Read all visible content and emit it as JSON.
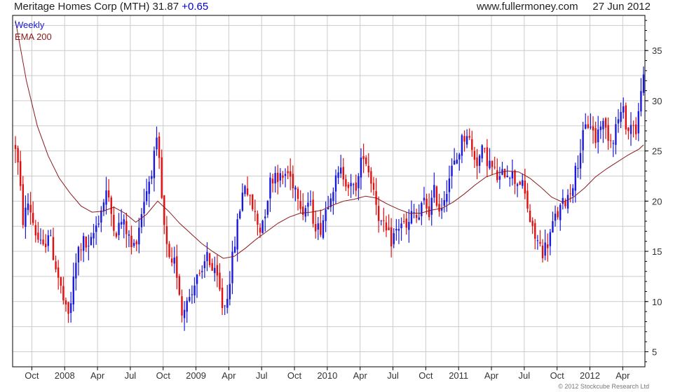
{
  "header": {
    "company": "Meritage Homes Corp (MTH)",
    "price": "31.87",
    "change": "+0.65",
    "site": "www.fullermoney.com",
    "date": "27 Jun 2012"
  },
  "legend": {
    "period": "Weekly",
    "indicator": "EMA 200"
  },
  "copyright": "© 2012 Stockcube Research Ltd",
  "colors": {
    "up": "#1a1adc",
    "down": "#e01010",
    "ema": "#8b1a1a",
    "grid": "#cccccc",
    "axis": "#000000"
  },
  "chart_data": {
    "type": "candlestick",
    "title": "Meritage Homes Corp (MTH) 31.87 +0.65",
    "frequency": "Weekly",
    "ylim": [
      3.5,
      38.5
    ],
    "y_ticks": [
      5,
      10,
      15,
      20,
      25,
      30,
      35
    ],
    "x_ticks": [
      {
        "label": "Oct",
        "t": 1.5
      },
      {
        "label": "2008",
        "t": 4.5
      },
      {
        "label": "Apr",
        "t": 7.5
      },
      {
        "label": "Jul",
        "t": 10.5
      },
      {
        "label": "Oct",
        "t": 13.5
      },
      {
        "label": "2009",
        "t": 16.5
      },
      {
        "label": "Apr",
        "t": 19.5
      },
      {
        "label": "Jul",
        "t": 22.5
      },
      {
        "label": "Oct",
        "t": 25.5
      },
      {
        "label": "2010",
        "t": 28.5
      },
      {
        "label": "Apr",
        "t": 31.5
      },
      {
        "label": "Jul",
        "t": 34.5
      },
      {
        "label": "Oct",
        "t": 37.5
      },
      {
        "label": "2011",
        "t": 40.5
      },
      {
        "label": "Apr",
        "t": 43.5
      },
      {
        "label": "Jul",
        "t": 46.5
      },
      {
        "label": "Oct",
        "t": 49.5
      },
      {
        "label": "2012",
        "t": 52.5
      },
      {
        "label": "Apr",
        "t": 55.5
      }
    ],
    "price_anchors": [
      [
        0,
        25.5
      ],
      [
        0.3,
        23
      ],
      [
        0.7,
        18
      ],
      [
        1.2,
        20
      ],
      [
        1.8,
        17
      ],
      [
        2.5,
        15
      ],
      [
        3,
        17
      ],
      [
        3.6,
        14
      ],
      [
        4.2,
        11
      ],
      [
        4.6,
        9
      ],
      [
        4.9,
        8.5
      ],
      [
        5.3,
        12
      ],
      [
        5.7,
        15
      ],
      [
        6.2,
        16
      ],
      [
        6.7,
        15
      ],
      [
        7.2,
        17
      ],
      [
        7.8,
        19
      ],
      [
        8.3,
        21
      ],
      [
        8.7,
        19
      ],
      [
        9.2,
        17
      ],
      [
        9.7,
        18
      ],
      [
        10.2,
        17
      ],
      [
        10.7,
        15
      ],
      [
        11.2,
        17
      ],
      [
        11.7,
        20
      ],
      [
        12.2,
        22
      ],
      [
        12.6,
        24
      ],
      [
        13,
        26
      ],
      [
        13.3,
        21
      ],
      [
        13.7,
        16
      ],
      [
        14.2,
        13
      ],
      [
        14.6,
        14
      ],
      [
        15,
        11
      ],
      [
        15.3,
        8
      ],
      [
        15.6,
        11
      ],
      [
        16,
        10
      ],
      [
        16.5,
        13
      ],
      [
        17,
        12
      ],
      [
        17.5,
        15
      ],
      [
        18,
        13
      ],
      [
        18.5,
        12
      ],
      [
        19,
        9
      ],
      [
        19.4,
        11
      ],
      [
        19.8,
        14
      ],
      [
        20.2,
        17
      ],
      [
        20.6,
        20
      ],
      [
        21,
        22
      ],
      [
        21.4,
        20
      ],
      [
        21.8,
        19
      ],
      [
        22.3,
        17
      ],
      [
        22.8,
        19
      ],
      [
        23.3,
        22
      ],
      [
        23.8,
        23
      ],
      [
        24.3,
        22
      ],
      [
        24.8,
        23
      ],
      [
        25.3,
        22
      ],
      [
        25.8,
        21
      ],
      [
        26.3,
        19
      ],
      [
        26.8,
        20
      ],
      [
        27.3,
        18
      ],
      [
        27.8,
        17
      ],
      [
        28.3,
        19
      ],
      [
        28.8,
        21
      ],
      [
        29.3,
        22
      ],
      [
        29.8,
        23
      ],
      [
        30.3,
        22
      ],
      [
        30.8,
        21
      ],
      [
        31.3,
        22
      ],
      [
        31.8,
        25
      ],
      [
        32.3,
        23
      ],
      [
        32.8,
        21
      ],
      [
        33.3,
        18
      ],
      [
        33.8,
        17
      ],
      [
        34.3,
        16
      ],
      [
        34.8,
        17
      ],
      [
        35.3,
        18
      ],
      [
        35.8,
        17
      ],
      [
        36.3,
        19
      ],
      [
        36.8,
        18
      ],
      [
        37.3,
        20
      ],
      [
        37.8,
        19
      ],
      [
        38.3,
        21
      ],
      [
        38.8,
        19
      ],
      [
        39.3,
        21
      ],
      [
        39.8,
        23
      ],
      [
        40.3,
        24
      ],
      [
        40.8,
        26
      ],
      [
        41.3,
        27
      ],
      [
        41.7,
        25
      ],
      [
        42.2,
        24
      ],
      [
        42.7,
        25
      ],
      [
        43.2,
        24
      ],
      [
        43.7,
        23
      ],
      [
        44.2,
        22
      ],
      [
        44.7,
        23
      ],
      [
        45.2,
        23
      ],
      [
        45.7,
        22
      ],
      [
        46.2,
        22
      ],
      [
        46.7,
        20
      ],
      [
        47.2,
        17
      ],
      [
        47.7,
        16
      ],
      [
        48.2,
        15
      ],
      [
        48.7,
        16
      ],
      [
        49.2,
        18
      ],
      [
        49.7,
        19
      ],
      [
        50.2,
        20
      ],
      [
        50.7,
        21
      ],
      [
        51.2,
        23
      ],
      [
        51.6,
        25
      ],
      [
        52,
        27
      ],
      [
        52.5,
        28
      ],
      [
        53,
        26
      ],
      [
        53.5,
        28
      ],
      [
        54,
        27
      ],
      [
        54.5,
        26
      ],
      [
        55,
        28
      ],
      [
        55.5,
        29
      ],
      [
        56,
        27
      ],
      [
        56.5,
        28
      ],
      [
        56.8,
        26
      ],
      [
        57.1,
        31.5
      ],
      [
        57.3,
        31.9
      ]
    ],
    "ema_anchors": [
      [
        0,
        38
      ],
      [
        1,
        32
      ],
      [
        2,
        27.5
      ],
      [
        3,
        24.5
      ],
      [
        4,
        22.3
      ],
      [
        5,
        20.8
      ],
      [
        6,
        19.5
      ],
      [
        7,
        18.9
      ],
      [
        8,
        19
      ],
      [
        9,
        19.4
      ],
      [
        10,
        18.8
      ],
      [
        11,
        17.9
      ],
      [
        12,
        18.7
      ],
      [
        13,
        20
      ],
      [
        14,
        19
      ],
      [
        15,
        17.8
      ],
      [
        16,
        16.8
      ],
      [
        17,
        15.8
      ],
      [
        18,
        15
      ],
      [
        19,
        14.3
      ],
      [
        20,
        14.5
      ],
      [
        21,
        15.3
      ],
      [
        22,
        16.2
      ],
      [
        23,
        17
      ],
      [
        24,
        17.8
      ],
      [
        25,
        18.4
      ],
      [
        26,
        18.8
      ],
      [
        27,
        18.9
      ],
      [
        28,
        19.1
      ],
      [
        29,
        19.6
      ],
      [
        30,
        20
      ],
      [
        31,
        20.2
      ],
      [
        32,
        20.5
      ],
      [
        33,
        20.3
      ],
      [
        34,
        19.7
      ],
      [
        35,
        19.2
      ],
      [
        36,
        18.8
      ],
      [
        37,
        18.8
      ],
      [
        38,
        19.1
      ],
      [
        39,
        19.3
      ],
      [
        40,
        19.9
      ],
      [
        41,
        20.7
      ],
      [
        42,
        21.6
      ],
      [
        43,
        22.4
      ],
      [
        44,
        22.8
      ],
      [
        45,
        23
      ],
      [
        46,
        22.9
      ],
      [
        47,
        22.3
      ],
      [
        48,
        21.4
      ],
      [
        49,
        20.4
      ],
      [
        50,
        19.9
      ],
      [
        51,
        20.4
      ],
      [
        52,
        21.3
      ],
      [
        53,
        22.4
      ],
      [
        54,
        23.2
      ],
      [
        55,
        23.9
      ],
      [
        56,
        24.6
      ],
      [
        57,
        25.2
      ],
      [
        57.4,
        25.6
      ]
    ],
    "y_tick_range": [
      3.5,
      38.5
    ],
    "note": "t axis = weeks/4.33 (approx. months) from start"
  }
}
